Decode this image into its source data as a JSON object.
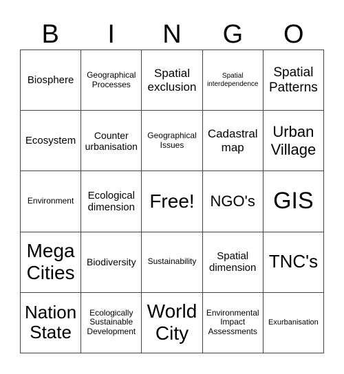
{
  "header": [
    "B",
    "I",
    "N",
    "G",
    "O"
  ],
  "cells": [
    [
      "Biosphere",
      "Geographical Processes",
      "Spatial exclusion",
      "Spatial interdependence",
      "Spatial Patterns"
    ],
    [
      "Ecosystem",
      "Counter urbanisation",
      "Geographical Issues",
      "Cadastral map",
      "Urban Village"
    ],
    [
      "Environment",
      "Ecological dimension",
      "Free!",
      "NGO's",
      "GIS"
    ],
    [
      "Mega Cities",
      "Biodiversity",
      "Sustainability",
      "Spatial dimension",
      "TNC's"
    ],
    [
      "Nation State",
      "Ecologically Sustainable Development",
      "World City",
      "Environmental Impact Assessments",
      "Exurbanisation"
    ]
  ]
}
